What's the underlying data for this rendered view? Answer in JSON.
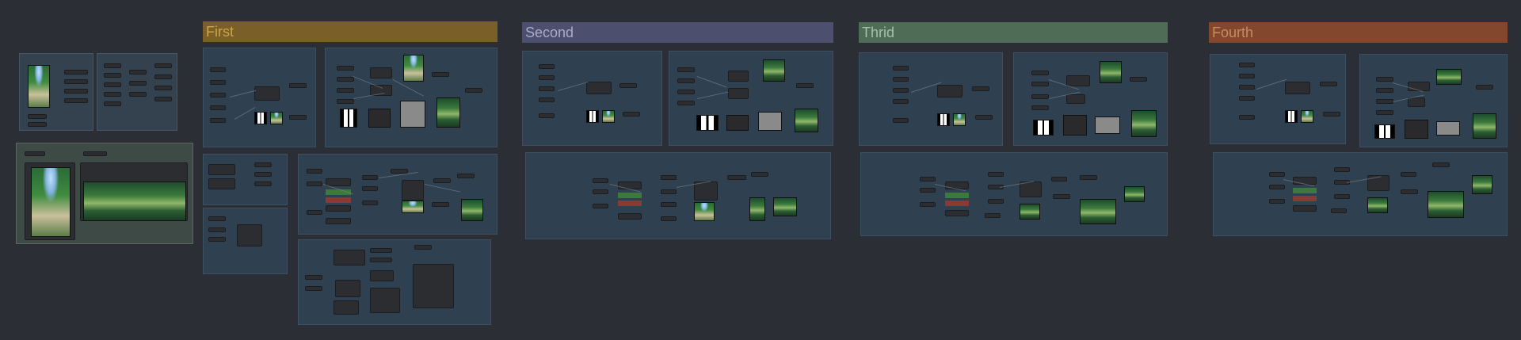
{
  "canvas": {
    "background": "#2b2e34"
  },
  "groups": [
    {
      "id": "first",
      "title": "First",
      "title_bg": "#7a5f28",
      "title_color": "#c9a54a"
    },
    {
      "id": "second",
      "title": "Second",
      "title_bg": "#4d4f6e",
      "title_color": "#a9abc9"
    },
    {
      "id": "thrid",
      "title": "Thrid",
      "title_bg": "#4f6c57",
      "title_color": "#a3c0a8"
    },
    {
      "id": "fourth",
      "title": "Fourth",
      "title_bg": "#83472d",
      "title_color": "#c98a60"
    }
  ],
  "colors": {
    "group_body": "#2f4050",
    "node": "#2c2d31",
    "wire": "#7d8a96",
    "positive_prompt": "#3b7a3b",
    "negative_prompt": "#8a3a33"
  }
}
